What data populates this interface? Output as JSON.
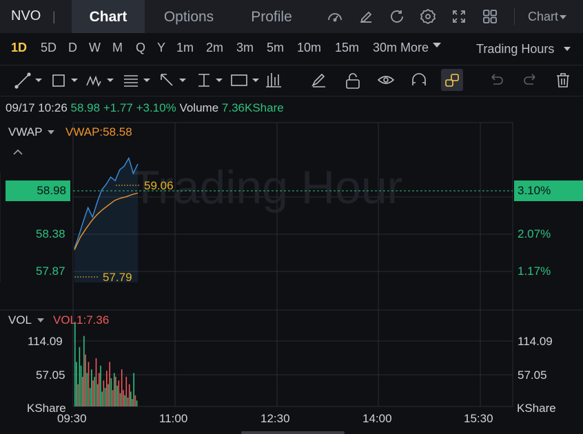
{
  "header": {
    "ticker": "NVO",
    "separator": "|",
    "tabs": [
      {
        "label": "Chart",
        "active": true
      },
      {
        "label": "Options",
        "active": false
      },
      {
        "label": "Profile",
        "active": false
      }
    ],
    "icons": [
      "gauge-icon",
      "edit-icon",
      "refresh-icon",
      "settings-icon",
      "fullscreen-icon",
      "layout-icon"
    ],
    "chart_menu_label": "Chart"
  },
  "periods": {
    "items": [
      "1D",
      "5D",
      "D",
      "W",
      "M",
      "Q",
      "Y",
      "1m",
      "2m",
      "3m",
      "5m",
      "10m",
      "15m",
      "30m"
    ],
    "active": "1D",
    "more_label": "More",
    "trading_hours_label": "Trading Hours"
  },
  "drawing_tools": [
    "trendline-icon",
    "rectangle-icon",
    "pattern-icon",
    "fibonacci-icon",
    "arrow-icon",
    "measure-icon",
    "text-icon",
    "candle-icon",
    "pen-icon",
    "unlock-icon",
    "eye-icon",
    "magnet-icon",
    "link-icon",
    "undo-icon",
    "redo-icon",
    "trash-icon"
  ],
  "quote": {
    "datetime": "09/17 10:26",
    "price": "58.98",
    "change": "+1.77",
    "change_pct": "+3.10%",
    "volume_label": "Volume",
    "volume_value": "7.36KShare"
  },
  "price_panel": {
    "indicator_label": "VWAP",
    "indicator_value": "VWAP:58.58",
    "watermark": "Trading Hour",
    "last_price": "58.98",
    "last_pct": "3.10%",
    "left_axis": [
      "58.38",
      "57.87"
    ],
    "right_axis": [
      "2.07%",
      "1.17%"
    ],
    "high_marker": "59.06",
    "low_marker": "57.79"
  },
  "volume_panel": {
    "indicator_label": "VOL",
    "indicator_value": "VOL1:7.36",
    "left_axis": [
      "114.09",
      "57.05",
      "KShare"
    ],
    "right_axis": [
      "114.09",
      "57.05",
      "KShare"
    ]
  },
  "time_axis": [
    "09:30",
    "11:00",
    "12:30",
    "14:00",
    "15:30"
  ],
  "colors": {
    "up": "#2ec27e",
    "down": "#ef5a5a",
    "price_line": "#3d8fe0",
    "vwap_line": "#f0952b",
    "marker": "#e6b422"
  },
  "chart_data": {
    "type": "line",
    "x_range": [
      "09:30",
      "16:00"
    ],
    "series": [
      {
        "name": "VWAP",
        "values": [
          57.8,
          57.97,
          58.09,
          58.2,
          58.29,
          58.36,
          58.42,
          58.48,
          58.51,
          58.53,
          58.56,
          58.58
        ]
      }
    ],
    "price": [
      57.82,
      58.0,
      58.2,
      58.38,
      58.25,
      58.45,
      58.62,
      58.7,
      58.8,
      58.75,
      58.9,
      58.95,
      59.06,
      58.85,
      58.98
    ],
    "ylim": [
      57.4,
      59.5
    ],
    "volume": [
      114,
      60,
      30,
      80,
      55,
      40,
      95,
      70,
      45,
      60,
      25,
      50,
      35,
      40,
      65,
      30,
      45,
      55,
      20,
      35,
      25,
      48,
      30,
      60,
      38,
      22,
      45,
      40,
      28,
      35,
      18,
      50,
      22,
      15,
      40,
      12,
      30,
      20,
      10,
      45,
      15,
      8
    ],
    "volume_colors": [
      "up",
      "up",
      "down",
      "up",
      "up",
      "down",
      "up",
      "down",
      "up",
      "down",
      "up",
      "up",
      "down",
      "up",
      "down",
      "up",
      "down",
      "up",
      "up",
      "down",
      "up",
      "down",
      "up",
      "down",
      "up",
      "down",
      "up",
      "down",
      "up",
      "down",
      "up",
      "down",
      "down",
      "up",
      "down",
      "up",
      "down",
      "up",
      "down",
      "up",
      "down",
      "up"
    ],
    "volume_ylim": [
      0,
      130
    ]
  }
}
